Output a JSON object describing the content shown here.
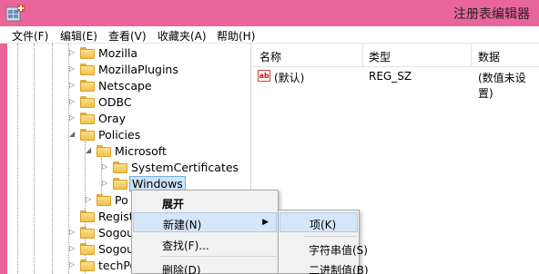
{
  "window": {
    "title": "注册表编辑器",
    "accent": "#e9659b"
  },
  "menubar": [
    "文件(F)",
    "编辑(E)",
    "查看(V)",
    "收藏夹(A)",
    "帮助(H)"
  ],
  "tree": [
    {
      "label": "Mozilla",
      "expander": "▷"
    },
    {
      "label": "MozillaPlugins",
      "expander": "▷"
    },
    {
      "label": "Netscape",
      "expander": "▷"
    },
    {
      "label": "ODBC",
      "expander": "▷"
    },
    {
      "label": "Oray",
      "expander": "▷"
    },
    {
      "label": "Policies",
      "expander": "◢"
    },
    {
      "label": "Microsoft",
      "expander": "◢"
    },
    {
      "label": "SystemCertificates",
      "expander": "▷"
    },
    {
      "label": "Windows",
      "expander": "▷"
    },
    {
      "label": "Po",
      "expander": "▷"
    },
    {
      "label": "Regist",
      "expander": ""
    },
    {
      "label": "Sogou",
      "expander": "▷"
    },
    {
      "label": "Sogou",
      "expander": "▷"
    },
    {
      "label": "techPo",
      "expander": "▷"
    }
  ],
  "list": {
    "columns": [
      "名称",
      "类型",
      "数据"
    ],
    "rows": [
      {
        "name": "(默认)",
        "type": "REG_SZ",
        "data": "(数值未设置)"
      }
    ]
  },
  "context_menu": {
    "items": [
      "展开",
      "新建(N)",
      "查找(F)...",
      "删除(D)"
    ],
    "submenu_arrow": "▶"
  },
  "submenu": {
    "items": [
      "项(K)",
      "字符串值(S)",
      "二进制值(B)"
    ]
  }
}
